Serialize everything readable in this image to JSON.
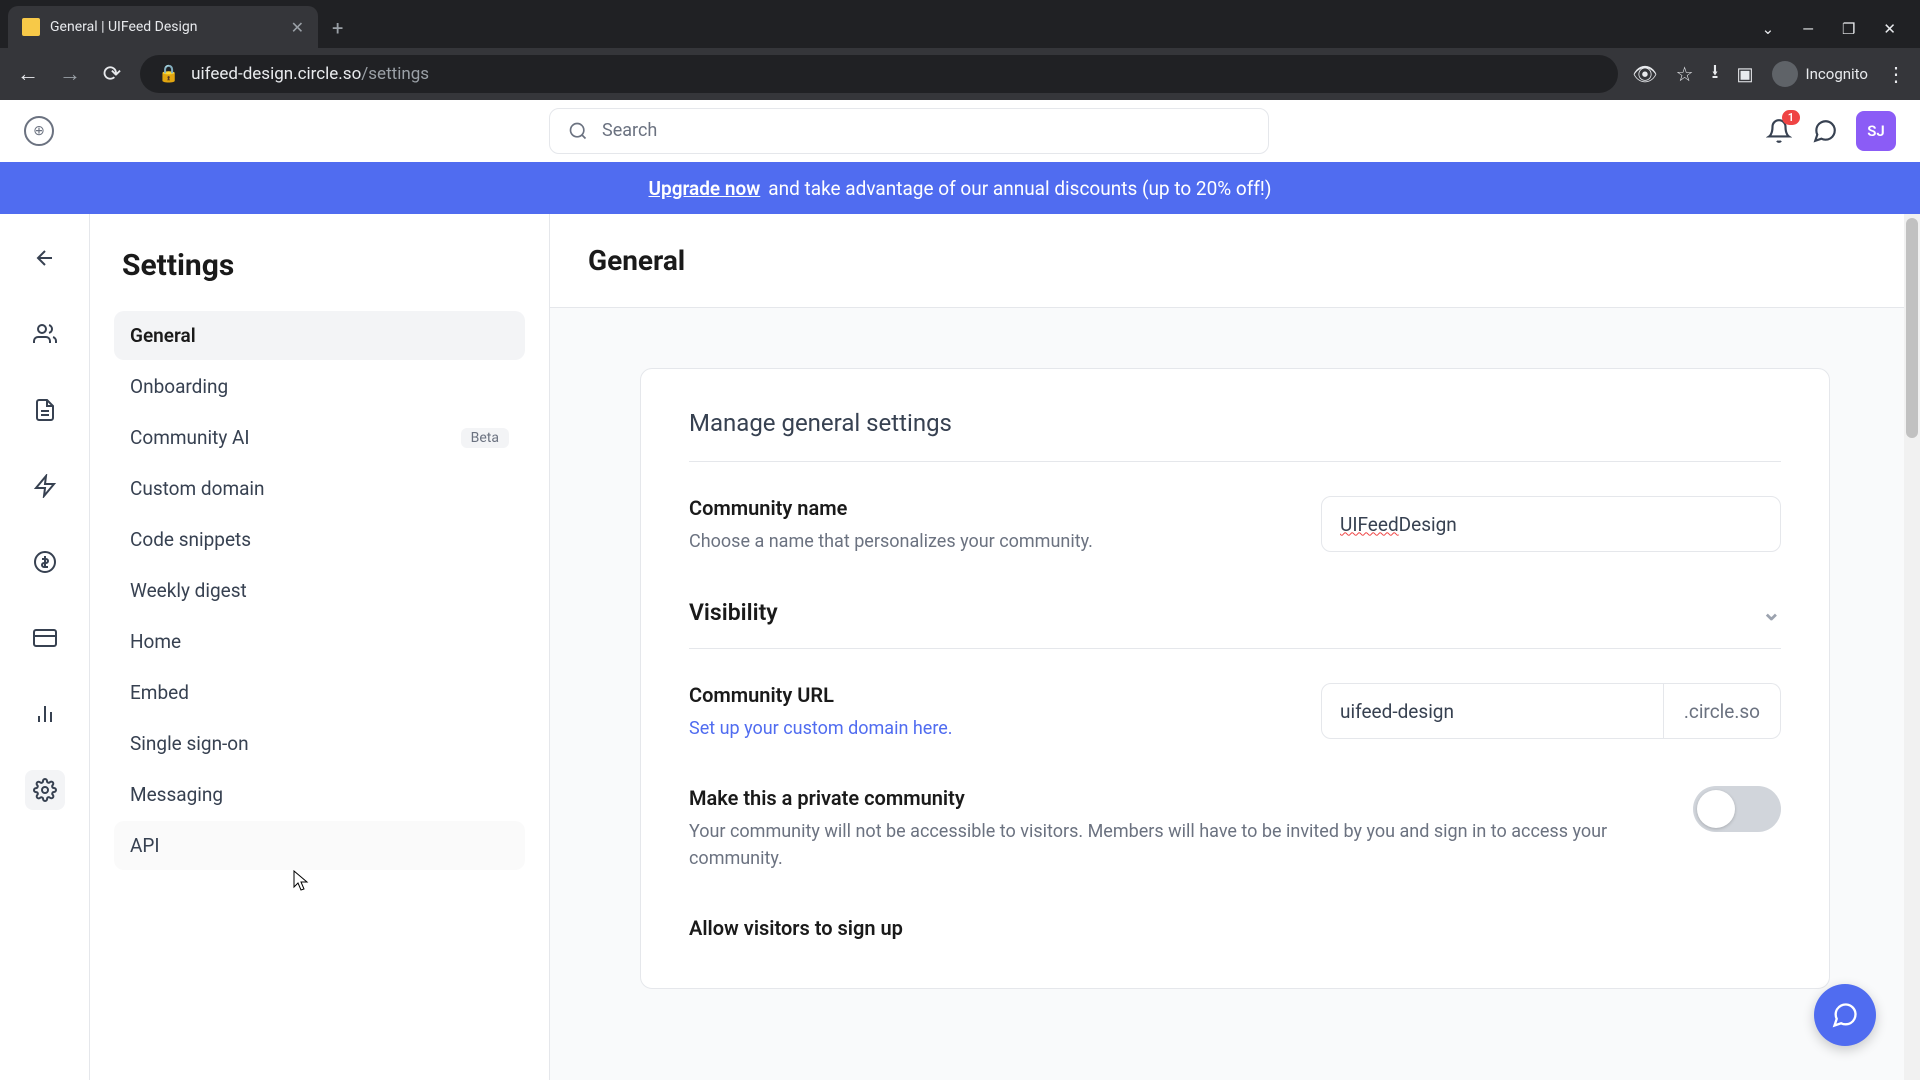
{
  "browser": {
    "tab_title": "General | UIFeed Design",
    "url_host": "uifeed-design.circle.so",
    "url_path": "/settings",
    "incognito_label": "Incognito"
  },
  "header": {
    "search_placeholder": "Search",
    "notification_count": "1",
    "avatar_initials": "SJ"
  },
  "banner": {
    "link_text": "Upgrade now",
    "rest_text": " and take advantage of our annual discounts (up to 20% off!)"
  },
  "sidebar": {
    "title": "Settings",
    "items": [
      {
        "label": "General",
        "active": true
      },
      {
        "label": "Onboarding"
      },
      {
        "label": "Community AI",
        "badge": "Beta"
      },
      {
        "label": "Custom domain"
      },
      {
        "label": "Code snippets"
      },
      {
        "label": "Weekly digest"
      },
      {
        "label": "Home"
      },
      {
        "label": "Embed"
      },
      {
        "label": "Single sign-on"
      },
      {
        "label": "Messaging"
      },
      {
        "label": "API"
      }
    ]
  },
  "content": {
    "title": "General",
    "card_title": "Manage general settings",
    "community_name": {
      "label": "Community name",
      "desc": "Choose a name that personalizes your community.",
      "value_misspelled": "UIFeed",
      "value_rest": " Design"
    },
    "visibility": {
      "label": "Visibility"
    },
    "community_url": {
      "label": "Community URL",
      "link": "Set up your custom domain here.",
      "value": "uifeed-design",
      "suffix": ".circle.so"
    },
    "private": {
      "label": "Make this a private community",
      "desc": "Your community will not be accessible to visitors. Members will have to be invited by you and sign in to access your community."
    },
    "allow_visitors": {
      "label": "Allow visitors to sign up"
    }
  }
}
